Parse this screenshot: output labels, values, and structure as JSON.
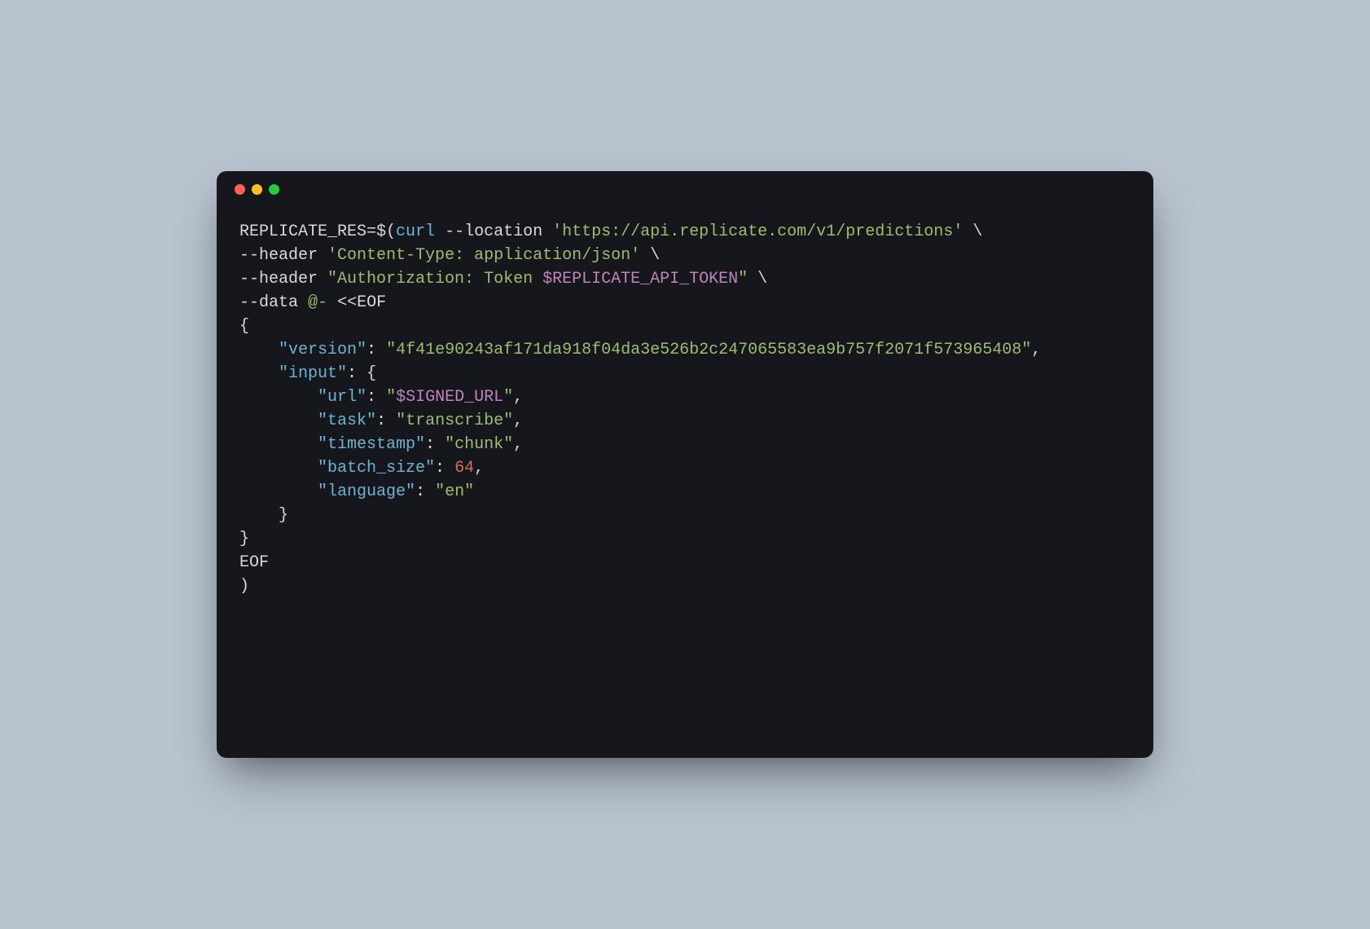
{
  "colors": {
    "background_page": "#b8c3cf",
    "window_bg": "#16171d",
    "traffic_red": "#ff5f57",
    "traffic_yellow": "#febc2e",
    "traffic_green": "#28c840",
    "text_default": "#d7d9de",
    "text_string": "#9fbd70",
    "text_keyword": "#6fb3d2",
    "text_number": "#d46c5c",
    "text_envvar": "#c084b8"
  },
  "code": {
    "assign_var": "REPLICATE_RES",
    "assign_op": "=$(",
    "cmd": "curl",
    "flag_location": "--location",
    "url": "'https://api.replicate.com/v1/predictions'",
    "flag_header": "--header",
    "header_ct": "'Content-Type: application/json'",
    "header_auth_pre": "\"Authorization: Token ",
    "header_auth_var": "$REPLICATE_API_TOKEN",
    "header_auth_post": "\"",
    "flag_data": "--data",
    "data_at": "@-",
    "heredoc_start": "<<EOF",
    "brace_open": "{",
    "brace_close": "}",
    "k_version": "\"version\"",
    "v_version": "\"4f41e90243af171da918f04da3e526b2c247065583ea9b757f2071f573965408\"",
    "k_input": "\"input\"",
    "k_url": "\"url\"",
    "v_url_pre": "\"",
    "v_url_var": "$SIGNED_URL",
    "v_url_post": "\"",
    "k_task": "\"task\"",
    "v_task": "\"transcribe\"",
    "k_timestamp": "\"timestamp\"",
    "v_timestamp": "\"chunk\"",
    "k_batch": "\"batch_size\"",
    "v_batch": "64",
    "k_lang": "\"language\"",
    "v_lang": "\"en\"",
    "eof": "EOF",
    "paren_close": ")",
    "backslash": "\\",
    "comma": ",",
    "colon": ":",
    "space": " ",
    "indent1": "    ",
    "indent2": "        "
  }
}
